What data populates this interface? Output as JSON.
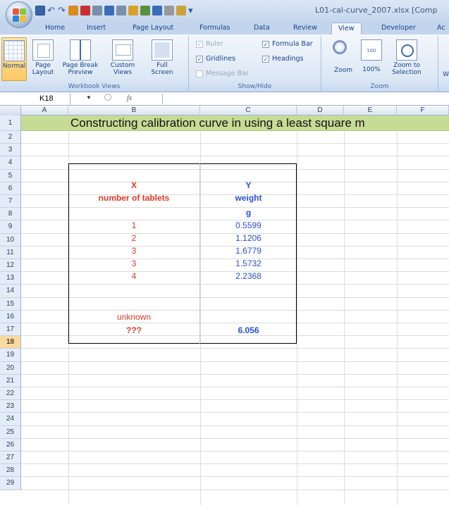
{
  "titlebar": {
    "title": "L01-cal-curve_2007.xlsx [Comp"
  },
  "tabs": [
    {
      "label": "Home",
      "active": false
    },
    {
      "label": "Insert",
      "active": false
    },
    {
      "label": "Page Layout",
      "active": false
    },
    {
      "label": "Formulas",
      "active": false
    },
    {
      "label": "Data",
      "active": false
    },
    {
      "label": "Review",
      "active": false
    },
    {
      "label": "View",
      "active": true
    },
    {
      "label": "Developer",
      "active": false
    },
    {
      "label": "Ac",
      "active": false
    }
  ],
  "ribbon": {
    "workbook_views": {
      "group_label": "Workbook Views",
      "normal": "Normal",
      "page_layout_1": "Page",
      "page_layout_2": "Layout",
      "page_break_1": "Page Break",
      "page_break_2": "Preview",
      "custom_1": "Custom",
      "custom_2": "Views",
      "full_1": "Full",
      "full_2": "Screen"
    },
    "show_hide": {
      "group_label": "Show/Hide",
      "ruler": "Ruler",
      "formula_bar": "Formula Bar",
      "gridlines": "Gridlines",
      "headings": "Headings",
      "message_bar": "Message Bar"
    },
    "zoom": {
      "group_label": "Zoom",
      "zoom": "Zoom",
      "hundred": "100%",
      "zoom_sel_1": "Zoom to",
      "zoom_sel_2": "Selection"
    },
    "more": "W"
  },
  "formula_bar": {
    "name_box": "K18",
    "fx": "fx",
    "formula": ""
  },
  "columns": [
    "A",
    "B",
    "C",
    "D",
    "E",
    "F"
  ],
  "rows": [
    "1",
    "2",
    "3",
    "4",
    "5",
    "6",
    "7",
    "8",
    "9",
    "10",
    "11",
    "12",
    "13",
    "14",
    "15",
    "16",
    "17",
    "18",
    "19",
    "20",
    "21",
    "22",
    "23",
    "24",
    "25",
    "26",
    "27",
    "28",
    "29"
  ],
  "selected_row": "18",
  "sheet": {
    "title": "Constructing calibration curve in  using a least square m",
    "x_header": "X",
    "x_desc": "number of tablets",
    "y_header": "Y",
    "y_desc": "weight",
    "y_unit": "g",
    "x_values": [
      "1",
      "2",
      "3",
      "3",
      "4"
    ],
    "y_values": [
      "0.5599",
      "1.1206",
      "1.6779",
      "1.5732",
      "2.2368"
    ],
    "unknown_label": "unknown",
    "unknown_x": "???",
    "unknown_y": "6.056"
  }
}
